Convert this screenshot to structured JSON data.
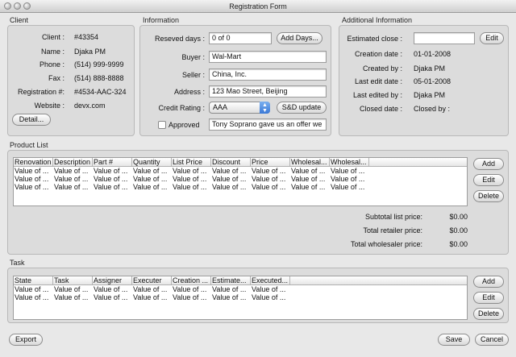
{
  "window": {
    "title": "Registration Form"
  },
  "client": {
    "section_label": "Client",
    "rows": [
      {
        "label": "Client :",
        "value": "#43354"
      },
      {
        "label": "Name :",
        "value": "Djaka PM"
      },
      {
        "label": "Phone :",
        "value": "(514) 999-9999"
      },
      {
        "label": "Fax :",
        "value": "(514) 888-8888"
      },
      {
        "label": "Registration #:",
        "value": "#4534-AAC-324"
      },
      {
        "label": "Website :",
        "value": "devx.com"
      }
    ],
    "detail_button": "Detail..."
  },
  "information": {
    "section_label": "Information",
    "reserved_days_label": "Reseved days :",
    "reserved_days_value": "0 of 0",
    "add_days_button": "Add Days...",
    "buyer_label": "Buyer :",
    "buyer_value": "Wal-Mart",
    "seller_label": "Seller :",
    "seller_value": "China, Inc.",
    "address_label": "Address :",
    "address_value": "123 Mao Street, Beijing",
    "credit_rating_label": "Credit Rating :",
    "credit_rating_value": "AAA",
    "sd_update_button": "S&D update",
    "approved_label": "Approved",
    "approved_checked": false,
    "note_value": "Tony Soprano gave us an offer we"
  },
  "additional": {
    "section_label": "Additional Information",
    "estimated_close_label": "Estimated close :",
    "estimated_close_value": "",
    "edit_button": "Edit",
    "rows": [
      {
        "label": "Creation date :",
        "value": "01-01-2008"
      },
      {
        "label": "Created by :",
        "value": "Djaka PM"
      },
      {
        "label": "Last edit date :",
        "value": "05-01-2008"
      },
      {
        "label": "Last edited by :",
        "value": "Djaka PM"
      },
      {
        "label": "Closed date :",
        "value": "Closed by :"
      }
    ]
  },
  "product_list": {
    "section_label": "Product List",
    "columns": [
      "Renovation",
      "Description",
      "Part #",
      "Quantity",
      "List Price",
      "Discount",
      "Price",
      "Wholesal...",
      "Wholesal..."
    ],
    "rows": [
      [
        "Value of ...",
        "Value of ...",
        "Value of ...",
        "Value of ...",
        "Value of ...",
        "Value of ...",
        "Value of ...",
        "Value of ...",
        "Value of ..."
      ],
      [
        "Value of ...",
        "Value of ...",
        "Value of ...",
        "Value of ...",
        "Value of ...",
        "Value of ...",
        "Value of ...",
        "Value of ...",
        "Value of ..."
      ],
      [
        "Value of ...",
        "Value of ...",
        "Value of ...",
        "Value of ...",
        "Value of ...",
        "Value of ...",
        "Value of ...",
        "Value of ...",
        "Value of ..."
      ]
    ],
    "add_button": "Add",
    "edit_button": "Edit",
    "delete_button": "Delete",
    "totals": [
      {
        "label": "Subtotal list price:",
        "value": "$0.00"
      },
      {
        "label": "Total retailer price:",
        "value": "$0.00"
      },
      {
        "label": "Total wholesaler price:",
        "value": "$0.00"
      }
    ]
  },
  "task": {
    "section_label": "Task",
    "columns": [
      "State",
      "Task",
      "Assigner",
      "Executer",
      "Creation ...",
      "Estimate...",
      "Executed..."
    ],
    "rows": [
      [
        "Value of ...",
        "Value of ...",
        "Value of ...",
        "Value of ...",
        "Value of ...",
        "Value of ...",
        "Value of ..."
      ],
      [
        "Value of ...",
        "Value of ...",
        "Value of ...",
        "Value of ...",
        "Value of ...",
        "Value of ...",
        "Value of ..."
      ]
    ],
    "add_button": "Add",
    "edit_button": "Edit",
    "delete_button": "Delete"
  },
  "footer": {
    "export_button": "Export",
    "save_button": "Save",
    "cancel_button": "Cancel"
  }
}
